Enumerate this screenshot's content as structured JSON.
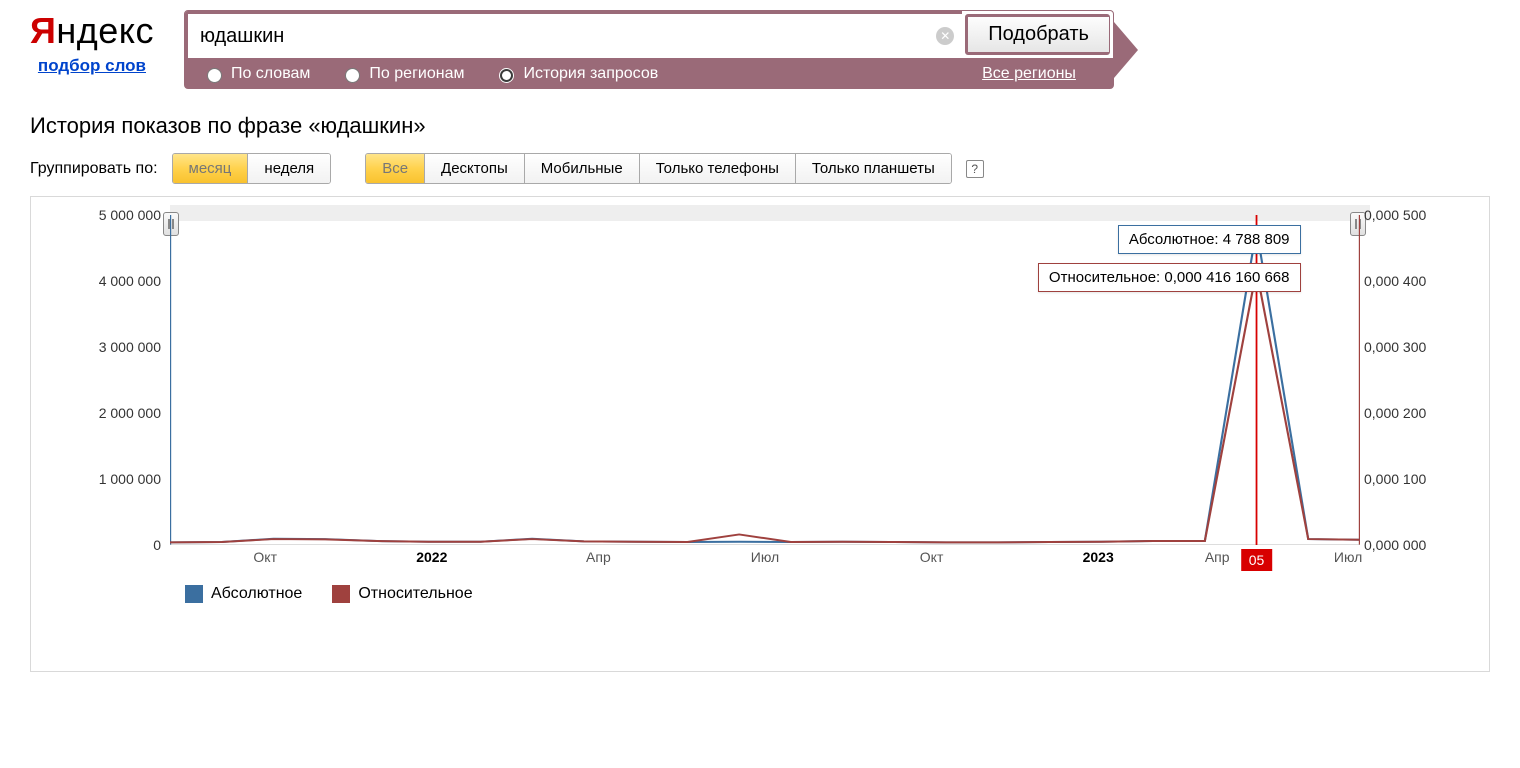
{
  "brand": {
    "name": "Яндекс",
    "sublink": "подбор слов"
  },
  "search": {
    "value": "юдашкин",
    "submit": "Подобрать",
    "tabs": {
      "words": "По словам",
      "regions": "По регионам",
      "history": "История запросов"
    },
    "region_filter": "Все регионы"
  },
  "heading": "История показов по фразе «юдашкин»",
  "controls": {
    "group_label": "Группировать по:",
    "group": {
      "month": "месяц",
      "week": "неделя"
    },
    "device": {
      "all": "Все",
      "desktop": "Десктопы",
      "mobile": "Мобильные",
      "phones": "Только телефоны",
      "tablets": "Только планшеты"
    }
  },
  "tooltip_abs": "Абсолютное: 4 788 809",
  "tooltip_rel": "Относительное: 0,000 416 160 668",
  "hover_month": "05",
  "legend": {
    "abs": "Абсолютное",
    "rel": "Относительное"
  },
  "y_left_labels": [
    "0",
    "1 000 000",
    "2 000 000",
    "3 000 000",
    "4 000 000",
    "5 000 000"
  ],
  "y_right_labels": [
    "0,000 000",
    "0,000 100",
    "0,000 200",
    "0,000 300",
    "0,000 400",
    "0,000 500"
  ],
  "x_axis": [
    {
      "label": "Окт",
      "bold": false,
      "pct": 8
    },
    {
      "label": "2022",
      "bold": true,
      "pct": 22
    },
    {
      "label": "Апр",
      "bold": false,
      "pct": 36
    },
    {
      "label": "Июл",
      "bold": false,
      "pct": 50
    },
    {
      "label": "Окт",
      "bold": false,
      "pct": 64
    },
    {
      "label": "2023",
      "bold": true,
      "pct": 78
    },
    {
      "label": "Апр",
      "bold": false,
      "pct": 88
    },
    {
      "label": "Июл",
      "bold": false,
      "pct": 99
    }
  ],
  "chart_data": {
    "type": "line",
    "title": "История показов по фразе «юдашкин»",
    "x_type": "time",
    "categories": [
      "2021-08",
      "2021-09",
      "2021-10",
      "2021-11",
      "2021-12",
      "2022-01",
      "2022-02",
      "2022-03",
      "2022-04",
      "2022-05",
      "2022-06",
      "2022-07",
      "2022-08",
      "2022-09",
      "2022-10",
      "2022-11",
      "2022-12",
      "2023-01",
      "2023-02",
      "2023-03",
      "2023-04",
      "2023-05",
      "2023-06",
      "2023-07"
    ],
    "series": [
      {
        "name": "Абсолютное",
        "axis": "left",
        "color": "#3b6fa0",
        "values": [
          40000,
          45000,
          95000,
          90000,
          60000,
          50000,
          50000,
          95000,
          55000,
          50000,
          45000,
          50000,
          45000,
          50000,
          45000,
          40000,
          40000,
          45000,
          50000,
          60000,
          60000,
          4788809,
          90000,
          80000
        ]
      },
      {
        "name": "Относительное",
        "axis": "right",
        "color": "#9f413e",
        "values": [
          4e-06,
          4.5e-06,
          9e-06,
          8.5e-06,
          6e-06,
          5e-06,
          5e-06,
          9e-06,
          5.5e-06,
          5e-06,
          4.5e-06,
          1.6e-05,
          4.5e-06,
          5e-06,
          4.5e-06,
          4e-06,
          4e-06,
          4.5e-06,
          5e-06,
          6e-06,
          6e-06,
          0.000416160668,
          9e-06,
          8e-06
        ]
      }
    ],
    "y_left": {
      "label": "",
      "range": [
        0,
        5000000
      ]
    },
    "y_right": {
      "label": "",
      "range": [
        0,
        0.0005
      ]
    },
    "hover_index": 21
  }
}
